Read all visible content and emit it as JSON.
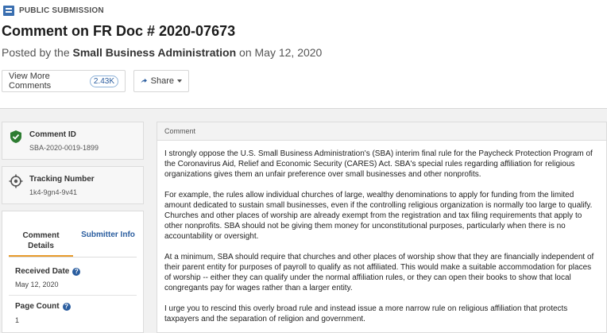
{
  "header": {
    "kicker": "PUBLIC SUBMISSION",
    "title": "Comment on FR Doc # 2020-07673",
    "posted_prefix": "Posted by the ",
    "agency": "Small Business Administration",
    "posted_suffix": " on May 12, 2020"
  },
  "actions": {
    "view_more_label": "View More Comments",
    "comment_count": "2.43K",
    "share_label": "Share"
  },
  "sidebar": {
    "comment_id_label": "Comment ID",
    "comment_id_value": "SBA-2020-0019-1899",
    "tracking_label": "Tracking Number",
    "tracking_value": "1k4-9gn4-9v41",
    "tabs": {
      "details_line1": "Comment",
      "details_line2": "Details",
      "submitter": "Submitter Info"
    },
    "fields": {
      "received_label": "Received Date",
      "received_value": "May 12, 2020",
      "page_count_label": "Page Count",
      "page_count_value": "1"
    }
  },
  "comment": {
    "heading": "Comment",
    "paragraphs": [
      "I strongly oppose the U.S. Small Business Administration's (SBA) interim final rule for the Paycheck Protection Program of the Coronavirus Aid, Relief and Economic Security (CARES) Act. SBA's special rules regarding affiliation for religious organizations gives them an unfair preference over small businesses and other nonprofits.",
      "For example, the rules allow individual churches of large, wealthy denominations to apply for funding from the limited amount dedicated to sustain small businesses, even if the controlling religious organization is normally too large to qualify. Churches and other places of worship are already exempt from the registration and tax filing requirements that apply to other nonprofits. SBA should not be giving them money for unconstitutional purposes, particularly when there is no accountability or oversight.",
      "At a minimum, SBA should require that churches and other places of worship show that they are financially independent of their parent entity for purposes of payroll to qualify as not affiliated. This would make a suitable accommodation for places of worship -- either they can qualify under the normal affiliation rules, or they can open their books to show that local congregants pay for wages rather than a larger entity.",
      "I urge you to rescind this overly broad rule and instead issue a more narrow rule on religious affiliation that protects taxpayers and the separation of religion and government."
    ]
  },
  "icons": {
    "kicker": "comment-doc-icon",
    "share": "share-icon",
    "comment_id": "shield-check-icon",
    "tracking": "target-icon",
    "help": "help-icon"
  },
  "colors": {
    "accent_blue": "#2a5d9f",
    "tab_underline": "#e89c2c",
    "shield_green": "#2e7d32"
  }
}
